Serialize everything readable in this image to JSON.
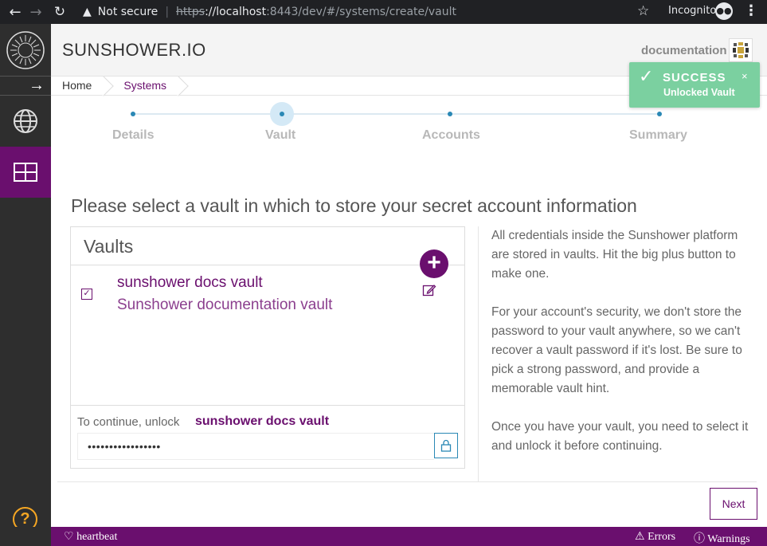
{
  "browser": {
    "security": "Not secure",
    "url_scheme": "https",
    "url_host": "://localhost",
    "url_rest": ":8443/dev/#/systems/create/vault",
    "mode": "Incognito"
  },
  "header": {
    "brand": "SUNSHOWER.IO",
    "user": "documentation"
  },
  "breadcrumb": [
    "Home",
    "Systems"
  ],
  "toast": {
    "title": "SUCCESS",
    "message": "Unlocked Vault",
    "close": "×",
    "color": "#7bd0a0"
  },
  "stepper": {
    "steps": [
      "Details",
      "Vault",
      "Accounts",
      "Summary"
    ],
    "active": "Vault"
  },
  "page": {
    "title": "Please select a vault in which to store your secret account information"
  },
  "vaults": {
    "heading": "Vaults",
    "add": "+",
    "items": [
      {
        "name": "sunshower docs vault",
        "description": "Sunshower documentation vault",
        "selected": true
      }
    ],
    "unlock_label": "To continue, unlock",
    "unlock_name": "sunshower docs vault",
    "password_masked": "•••••••••••••••••"
  },
  "info": {
    "p1": "All credentials inside the Sunshower platform are stored in vaults. Hit the big plus button to make one.",
    "p2": "For your account's security, we don't store the password to your vault anywhere, so we can't recover a vault password if it's lost. Be sure to pick a strong password, and provide a memorable vault hint.",
    "p3": "Once you have your vault, you need to select it and unlock it before continuing."
  },
  "actions": {
    "next": "Next"
  },
  "statusbar": {
    "heartbeat": "heartbeat",
    "errors": "Errors",
    "warnings": "Warnings"
  },
  "colors": {
    "accent": "#6a0f6e",
    "step": "#2a88b5",
    "rail": "#2e2e2e",
    "help": "#f5a623"
  }
}
